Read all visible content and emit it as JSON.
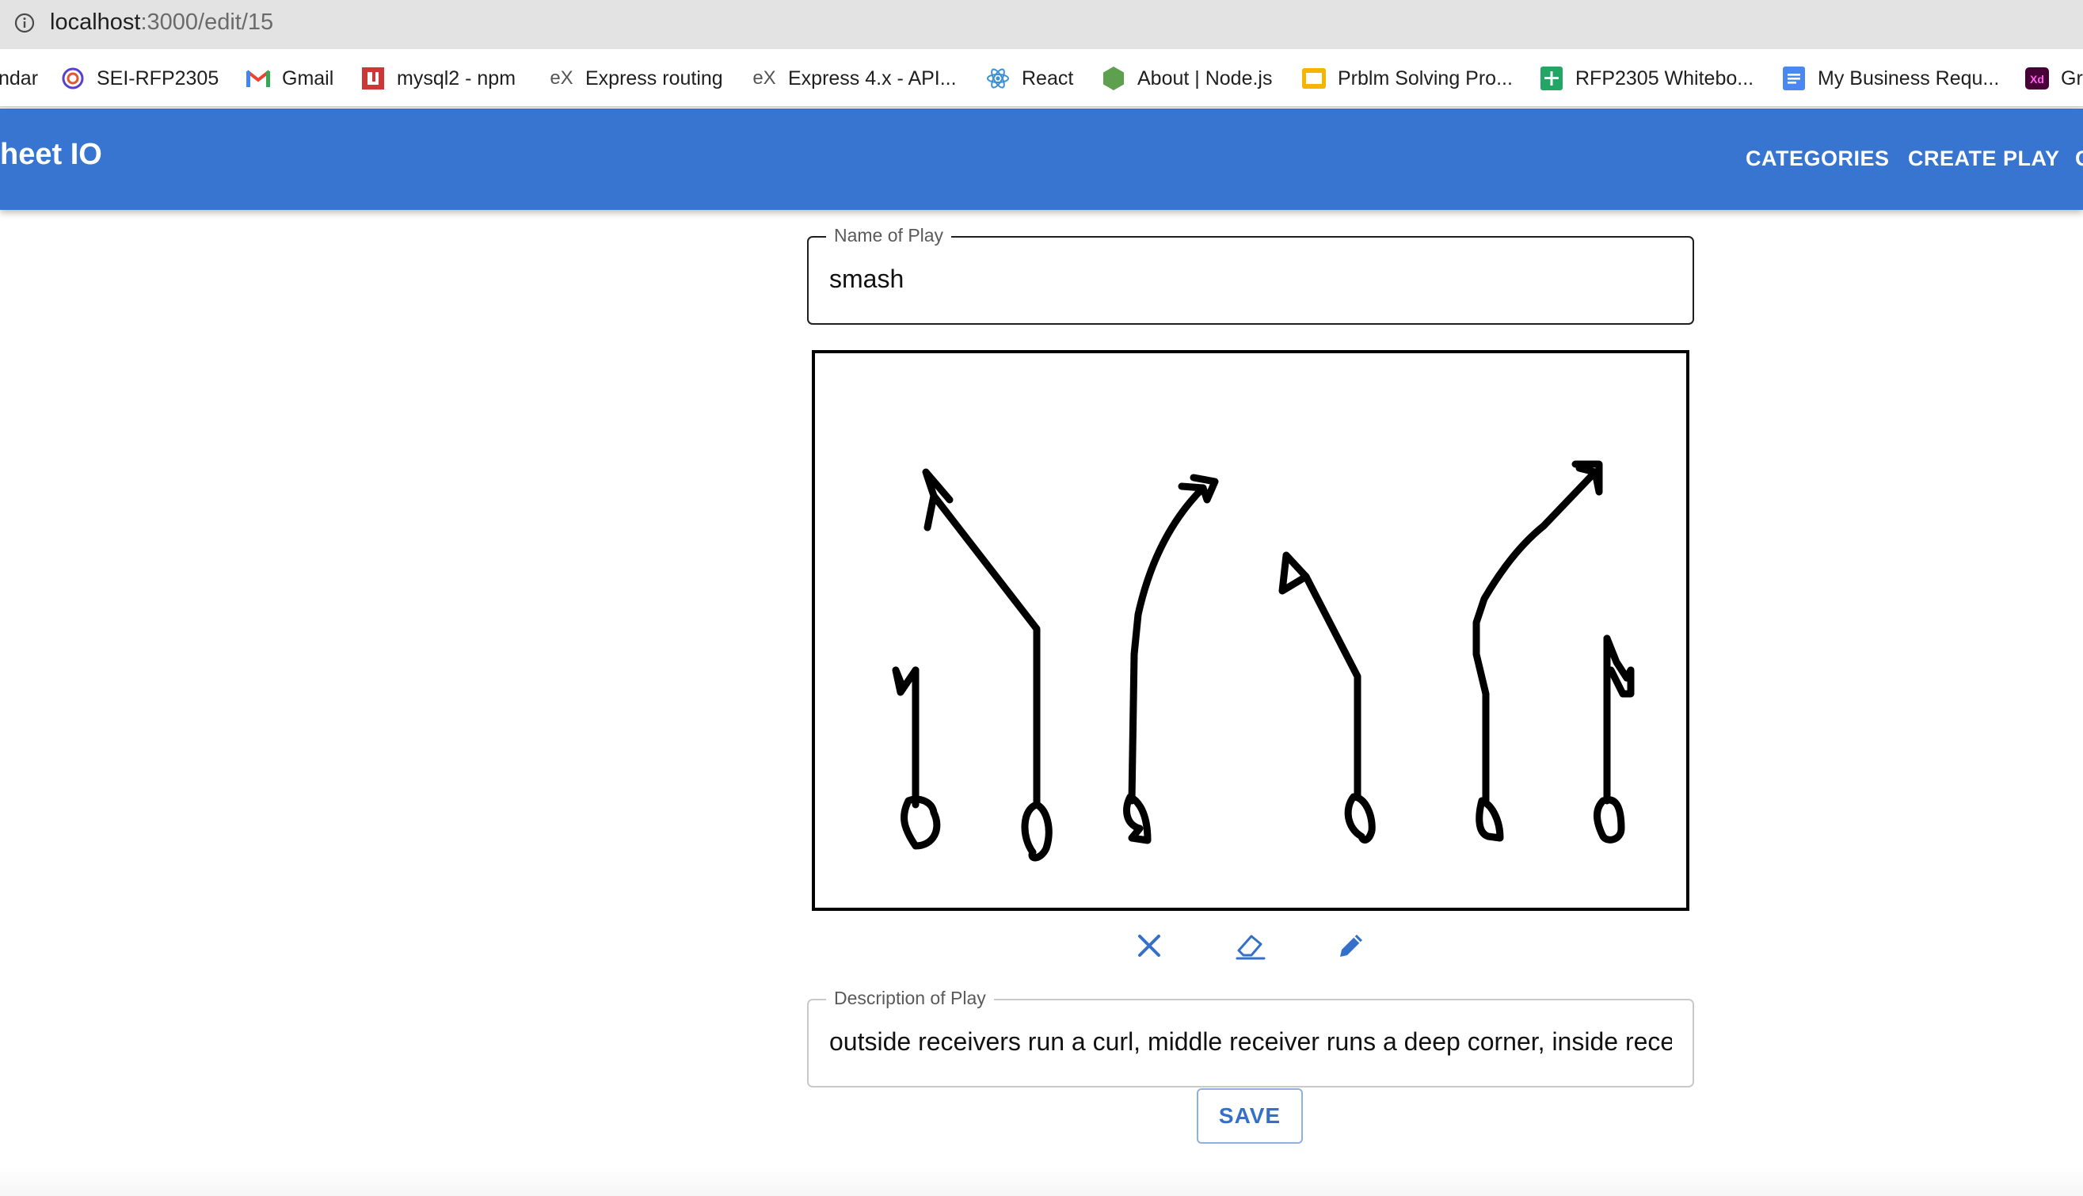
{
  "browser": {
    "url_host": "localhost",
    "url_rest": ":3000/edit/15"
  },
  "bookmarks": [
    {
      "label": "ndar",
      "icon": "calendar-icon"
    },
    {
      "label": "SEI-RFP2305",
      "icon": "ring-icon"
    },
    {
      "label": "Gmail",
      "icon": "gmail-icon"
    },
    {
      "label": "mysql2 - npm",
      "icon": "npm-icon"
    },
    {
      "label": "Express routing",
      "icon": "express-icon"
    },
    {
      "label": "Express 4.x - API...",
      "icon": "express-icon"
    },
    {
      "label": "React",
      "icon": "react-icon"
    },
    {
      "label": "About | Node.js",
      "icon": "nodejs-icon"
    },
    {
      "label": "Prblm Solving Pro...",
      "icon": "slides-icon"
    },
    {
      "label": "RFP2305 Whitebo...",
      "icon": "sheets-icon"
    },
    {
      "label": "My Business Requ...",
      "icon": "docs-icon"
    },
    {
      "label": "Gr",
      "icon": "xd-icon"
    }
  ],
  "appbar": {
    "title": "heet IO",
    "nav": [
      "CATEGORIES",
      "CREATE PLAY",
      "C"
    ]
  },
  "form": {
    "name_label": "Name of Play",
    "name_value": "smash",
    "description_label": "Description of Play",
    "description_value": "outside receivers run a curl, middle receiver runs a deep corner, inside receivers",
    "save_label": "SAVE"
  },
  "tools": [
    "close-icon",
    "eraser-icon",
    "pencil-icon"
  ],
  "colors": {
    "appbar": "#3875d0",
    "accent": "#3470c9"
  }
}
